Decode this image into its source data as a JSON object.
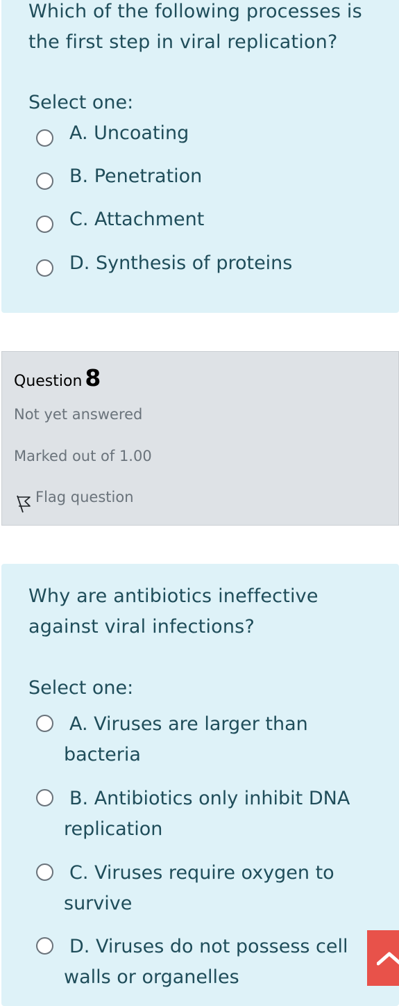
{
  "question7": {
    "text": "Which of the following processes is the first step in viral replication?",
    "prompt": "Select one:",
    "options": [
      "A. Uncoating",
      "B. Penetration",
      "C. Attachment",
      "D. Synthesis of proteins"
    ]
  },
  "question8": {
    "label": "Question",
    "number": "8",
    "state": "Not yet answered",
    "grade": "Marked out of 1.00",
    "flag_label": "Flag question",
    "flag_icon": "flag-icon",
    "text": "Why are antibiotics ineffective against viral infections?",
    "prompt": "Select one:",
    "options": [
      "A. Viruses are larger than bacteria",
      "B. Antibiotics only inhibit DNA replication",
      "C. Viruses require oxygen to survive",
      "D. Viruses do not possess cell walls or organelles"
    ]
  },
  "scroll_top_icon": "chevron-up-icon",
  "colors": {
    "question_bg": "#def2f8",
    "info_bg": "#dee2e6",
    "text": "#1f4d5a",
    "scroll_button": "#e8524a"
  }
}
